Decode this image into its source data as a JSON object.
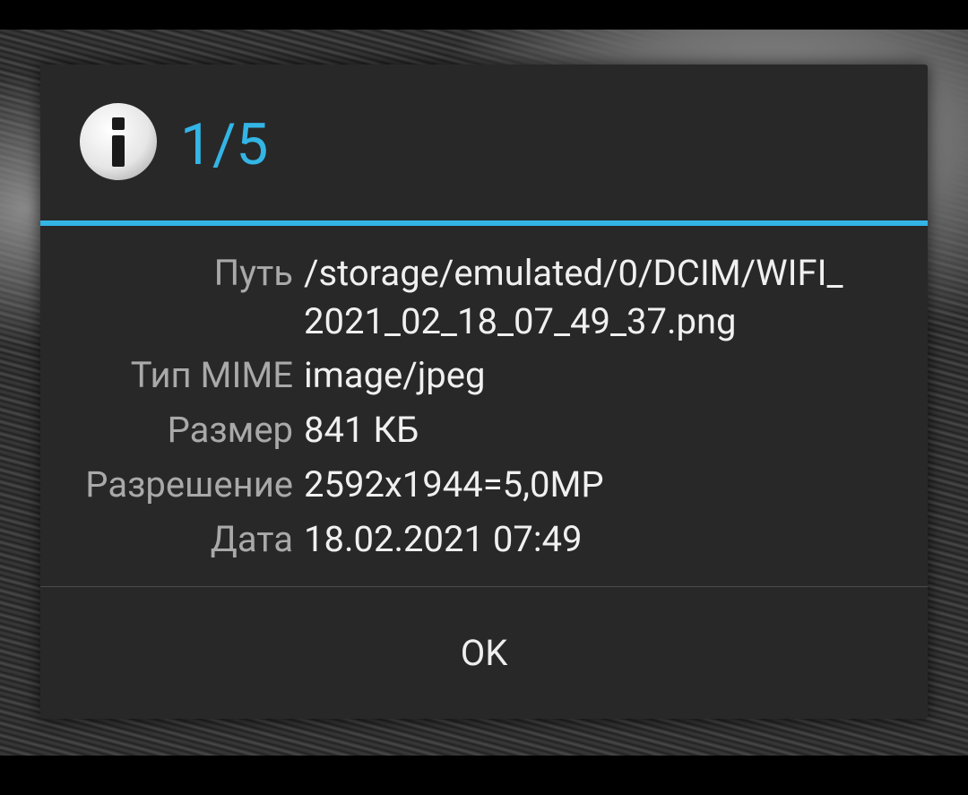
{
  "dialog": {
    "title": "1/5",
    "icon": "info-icon",
    "accent_color": "#33b5e5",
    "rows": [
      {
        "label": "Путь",
        "value_line1": "/storage/emulated/0/DCIM/WIFI_",
        "value_line2": "2021_02_18_07_49_37.png"
      },
      {
        "label": "Тип MIME",
        "value": "image/jpeg"
      },
      {
        "label": "Размер",
        "value": "841 КБ"
      },
      {
        "label": "Разрешение",
        "value": "2592x1944=5,0MP"
      },
      {
        "label": "Дата",
        "value": "18.02.2021 07:49"
      }
    ],
    "ok_label": "OK"
  }
}
